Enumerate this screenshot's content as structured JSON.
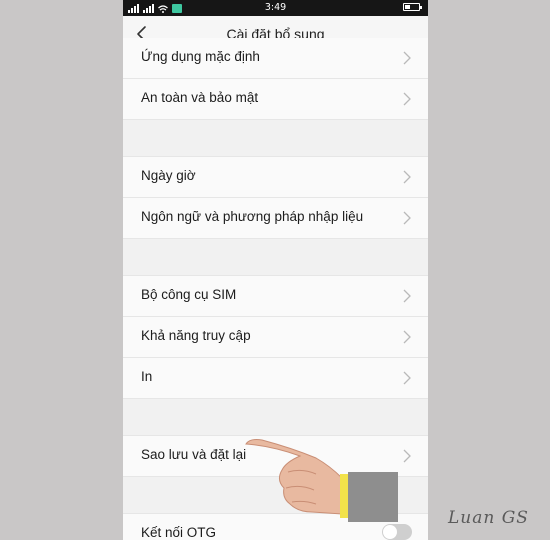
{
  "status_bar": {
    "time": "3:49",
    "icons": [
      "signal-icon",
      "signal-icon",
      "wifi-icon",
      "app-badge-icon",
      "battery-icon"
    ]
  },
  "header": {
    "title": "Cài đặt bổ sung",
    "back_icon": "chevron-left-icon"
  },
  "settings": {
    "items": [
      {
        "label": "Ứng dụng mặc định"
      },
      {
        "label": "An toàn và bảo mật"
      },
      {
        "label": "Ngày giờ"
      },
      {
        "label": "Ngôn ngữ và phương pháp nhập liệu"
      },
      {
        "label": "Bộ công cụ SIM"
      },
      {
        "label": "Khả năng truy cập"
      },
      {
        "label": "In"
      },
      {
        "label": "Sao lưu và đặt lại"
      },
      {
        "label": "Kết nối OTG",
        "toggle": "off"
      }
    ]
  },
  "watermark": "Luan GS",
  "colors": {
    "background": "#c9c7c7",
    "status_bar": "#161616",
    "list_bg": "#fafafa",
    "divider": "#e6e6e6",
    "toggle_off": "#cfcfcf"
  }
}
